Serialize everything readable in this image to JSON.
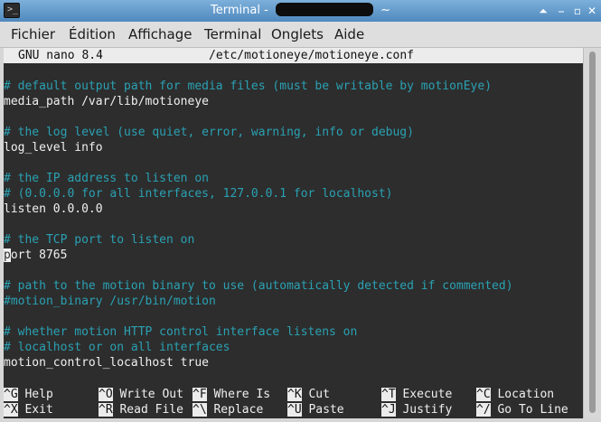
{
  "window": {
    "title_prefix": "Terminal - ",
    "title_suffix": " ~",
    "app_icon_glyph": ">_",
    "buttons": {
      "shade": "⏶",
      "minimize": "⎯",
      "maximize": "▫",
      "close": "✕"
    }
  },
  "menubar": {
    "items": [
      "Fichier",
      "Édition",
      "Affichage",
      "Terminal",
      "Onglets",
      "Aide"
    ]
  },
  "nano": {
    "version": "GNU nano 8.4",
    "filename": "/etc/motioneye/motioneye.conf",
    "lines": [
      {
        "type": "blank",
        "text": ""
      },
      {
        "type": "comment",
        "text": "# default output path for media files (must be writable by motionEye)"
      },
      {
        "type": "config",
        "text": "media_path /var/lib/motioneye"
      },
      {
        "type": "blank",
        "text": ""
      },
      {
        "type": "comment",
        "text": "# the log level (use quiet, error, warning, info or debug)"
      },
      {
        "type": "config",
        "text": "log_level info"
      },
      {
        "type": "blank",
        "text": ""
      },
      {
        "type": "comment",
        "text": "# the IP address to listen on"
      },
      {
        "type": "comment",
        "text": "# (0.0.0.0 for all interfaces, 127.0.0.1 for localhost)"
      },
      {
        "type": "config",
        "text": "listen 0.0.0.0"
      },
      {
        "type": "blank",
        "text": ""
      },
      {
        "type": "comment",
        "text": "# the TCP port to listen on"
      },
      {
        "type": "cursor",
        "cursor_char": "p",
        "text": "ort 8765"
      },
      {
        "type": "blank",
        "text": ""
      },
      {
        "type": "comment",
        "text": "# path to the motion binary to use (automatically detected if commented)"
      },
      {
        "type": "comment",
        "text": "#motion_binary /usr/bin/motion"
      },
      {
        "type": "blank",
        "text": ""
      },
      {
        "type": "comment",
        "text": "# whether motion HTTP control interface listens on"
      },
      {
        "type": "comment",
        "text": "# localhost or on all interfaces"
      },
      {
        "type": "config",
        "text": "motion_control_localhost true"
      }
    ],
    "shortcuts": [
      [
        {
          "key": "^G",
          "label": "Help"
        },
        {
          "key": "^O",
          "label": "Write Out"
        },
        {
          "key": "^F",
          "label": "Where Is"
        },
        {
          "key": "^K",
          "label": "Cut"
        },
        {
          "key": "^T",
          "label": "Execute"
        },
        {
          "key": "^C",
          "label": "Location"
        }
      ],
      [
        {
          "key": "^X",
          "label": "Exit"
        },
        {
          "key": "^R",
          "label": "Read File"
        },
        {
          "key": "^\\",
          "label": "Replace"
        },
        {
          "key": "^U",
          "label": "Paste"
        },
        {
          "key": "^J",
          "label": "Justify"
        },
        {
          "key": "^/",
          "label": "Go To Line"
        }
      ]
    ]
  },
  "colors": {
    "terminal_bg": "#2d2d2d",
    "comment": "#2aa1b3",
    "text": "#f0f0f0",
    "titlebar": "#5b93c7"
  }
}
